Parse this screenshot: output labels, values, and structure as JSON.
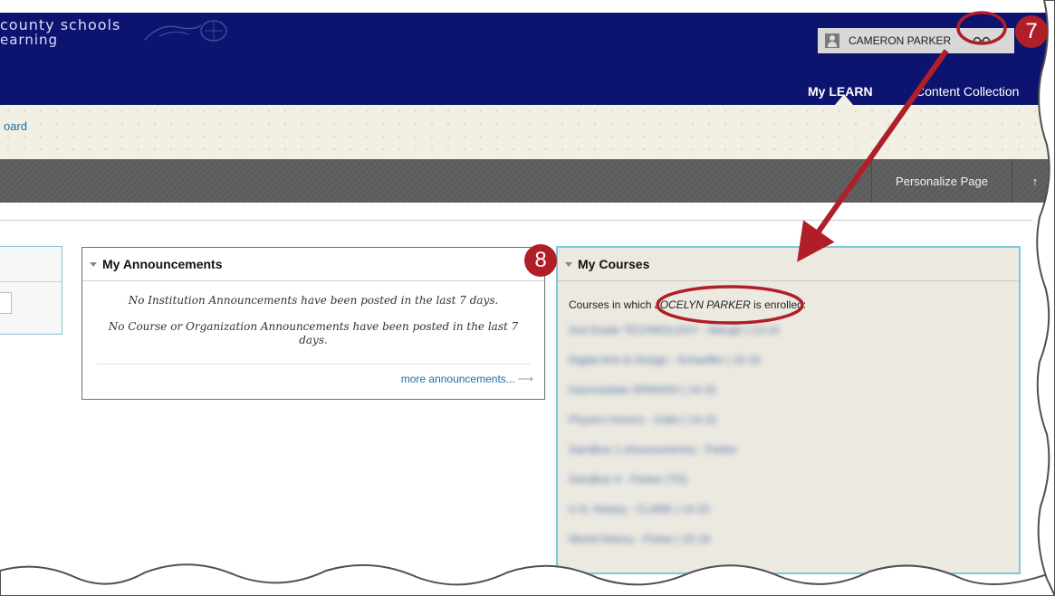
{
  "header": {
    "brand_line1": "county schools",
    "brand_line2": "earning",
    "user_name": "CAMERON PARKER",
    "tabs": [
      {
        "label": "My LEARN",
        "active": true
      },
      {
        "label": "Content Collection",
        "active": false
      }
    ]
  },
  "breadcrumb": {
    "text": "oard"
  },
  "toolbar": {
    "personalize_label": "Personalize Page",
    "toggle_label": "↑"
  },
  "announcements": {
    "title": "My Announcements",
    "message_institution": "No Institution Announcements have been posted in the last 7 days.",
    "message_course": "No Course or Organization Announcements have been posted in the last 7 days.",
    "more_link": "more announcements...",
    "more_arrow": "⟶"
  },
  "courses": {
    "title": "My Courses",
    "enrolled_prefix": "Courses in which ",
    "enrolled_user": "JOCELYN PARKER",
    "enrolled_suffix": " is enrolled:",
    "items": [
      "2nd Grade TECHNOLOGY - Waugh | 13-14",
      "Digital Arts & Design - Schaeffer | 15-16",
      "Intermediate SPANISH | 14-15",
      "Physics Honors - Gatts | 14-15",
      "Sandbox 1 (Assessments) - Parker",
      "Sandbox 4 - Parker (TD)",
      "U.S. History - CLARK | 14-15",
      "World History - Fisher | 15-16"
    ]
  },
  "annotations": {
    "badge_7": "7",
    "badge_8": "8",
    "color": "#b01f27"
  },
  "icons": [
    "user-icon",
    "glasses-icon",
    "collapse-triangle-icon",
    "arrow-right-icon"
  ],
  "colors": {
    "header_bg": "#0d1470",
    "toolbar_bg": "#5b5b5b",
    "link": "#1d6fa5",
    "module_border": "#7ccad8",
    "courses_bg": "#ece9e1"
  }
}
